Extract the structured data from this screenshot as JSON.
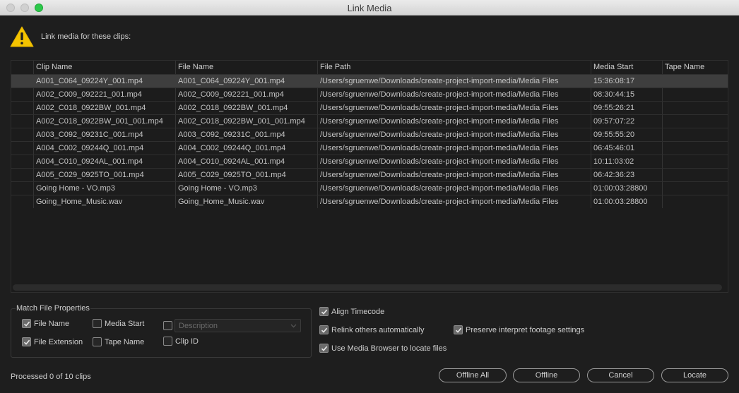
{
  "window": {
    "title": "Link Media"
  },
  "header": {
    "message": "Link media for these clips:",
    "icon": "warning-icon"
  },
  "table": {
    "columns": [
      "Clip Name",
      "File Name",
      "File Path",
      "Media Start",
      "Tape Name"
    ],
    "rows": [
      [
        "A001_C064_09224Y_001.mp4",
        "A001_C064_09224Y_001.mp4",
        "/Users/sgruenwe/Downloads/create-project-import-media/Media Files",
        "15:36:08:17",
        ""
      ],
      [
        "A002_C009_092221_001.mp4",
        "A002_C009_092221_001.mp4",
        "/Users/sgruenwe/Downloads/create-project-import-media/Media Files",
        "08:30:44:15",
        ""
      ],
      [
        "A002_C018_0922BW_001.mp4",
        "A002_C018_0922BW_001.mp4",
        "/Users/sgruenwe/Downloads/create-project-import-media/Media Files",
        "09:55:26:21",
        ""
      ],
      [
        "A002_C018_0922BW_001_001.mp4",
        "A002_C018_0922BW_001_001.mp4",
        "/Users/sgruenwe/Downloads/create-project-import-media/Media Files",
        "09:57:07:22",
        ""
      ],
      [
        "A003_C092_09231C_001.mp4",
        "A003_C092_09231C_001.mp4",
        "/Users/sgruenwe/Downloads/create-project-import-media/Media Files",
        "09:55:55:20",
        ""
      ],
      [
        "A004_C002_09244Q_001.mp4",
        "A004_C002_09244Q_001.mp4",
        "/Users/sgruenwe/Downloads/create-project-import-media/Media Files",
        "06:45:46:01",
        ""
      ],
      [
        "A004_C010_0924AL_001.mp4",
        "A004_C010_0924AL_001.mp4",
        "/Users/sgruenwe/Downloads/create-project-import-media/Media Files",
        "10:11:03:02",
        ""
      ],
      [
        "A005_C029_0925TO_001.mp4",
        "A005_C029_0925TO_001.mp4",
        "/Users/sgruenwe/Downloads/create-project-import-media/Media Files",
        "06:42:36:23",
        ""
      ],
      [
        "Going Home - VO.mp3",
        "Going Home - VO.mp3",
        "/Users/sgruenwe/Downloads/create-project-import-media/Media Files",
        "01:00:03:28800",
        ""
      ],
      [
        "Going_Home_Music.wav",
        "Going_Home_Music.wav",
        "/Users/sgruenwe/Downloads/create-project-import-media/Media Files",
        "01:00:03:28800",
        ""
      ]
    ]
  },
  "match_props": {
    "title": "Match File Properties",
    "file_name": {
      "label": "File Name",
      "checked": true
    },
    "media_start": {
      "label": "Media Start",
      "checked": false
    },
    "description": {
      "label": "Description",
      "checked": false
    },
    "file_extension": {
      "label": "File Extension",
      "checked": true
    },
    "tape_name": {
      "label": "Tape Name",
      "checked": false
    },
    "clip_id": {
      "label": "Clip ID",
      "checked": false
    }
  },
  "options": {
    "align_timecode": {
      "label": "Align Timecode",
      "checked": true
    },
    "relink_others": {
      "label": "Relink others automatically",
      "checked": true
    },
    "preserve_interpret": {
      "label": "Preserve interpret footage settings",
      "checked": true
    },
    "media_browser": {
      "label": "Use Media Browser to locate files",
      "checked": true
    }
  },
  "status": {
    "text": "Processed 0 of 10 clips"
  },
  "buttons": {
    "offline_all": "Offline All",
    "offline": "Offline",
    "cancel": "Cancel",
    "locate": "Locate"
  },
  "colors": {
    "accent_warning": "#f5c400",
    "background": "#1e1e1e",
    "selected_row": "#3e3e3e"
  }
}
